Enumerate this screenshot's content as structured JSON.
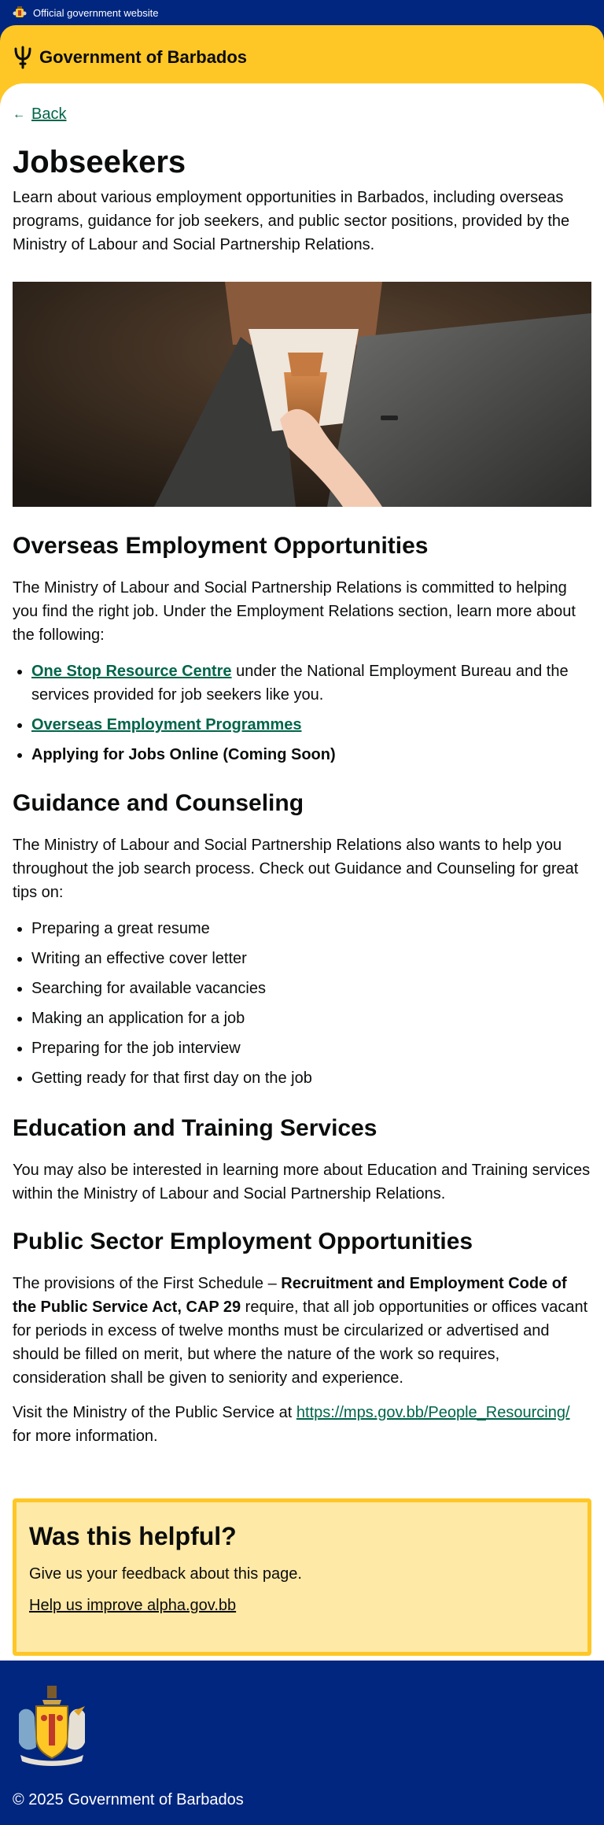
{
  "topbar": {
    "text": "Official government website"
  },
  "header": {
    "site_name": "Government of Barbados"
  },
  "back": {
    "label": "Back"
  },
  "page": {
    "title": "Jobseekers",
    "intro": "Learn about various employment opportunities in Barbados, including overseas programs, guidance for job seekers, and public sector positions, provided by the Ministry of Labour and Social Partnership Relations."
  },
  "overseas": {
    "heading": "Overseas Employment Opportunities",
    "paragraph": "The Ministry of Labour and Social Partnership Relations is committed to helping you find the right job. Under the Employment Relations section, learn more about the following:",
    "item1_link": "One Stop Resource Centre",
    "item1_rest": " under the National Employment Bureau and the services provided for job seekers like you.",
    "item2_link": "Overseas Employment Programmes",
    "item3": "Applying for Jobs Online (Coming Soon)"
  },
  "guidance": {
    "heading": "Guidance and Counseling",
    "paragraph": "The Ministry of Labour and Social Partnership Relations also wants to help you throughout the job search process. Check out Guidance and Counseling for great tips on:",
    "items": [
      "Preparing a great resume",
      "Writing an effective cover letter",
      "Searching for available vacancies",
      "Making an application for a job",
      "Preparing for the job interview",
      "Getting ready for that first day on the job"
    ]
  },
  "education": {
    "heading": "Education and Training Services",
    "paragraph": "You may also be interested in learning more about Education and Training services within the Ministry of Labour and Social Partnership Relations."
  },
  "public_sector": {
    "heading": "Public Sector Employment Opportunities",
    "p1_start": "The provisions of the First Schedule – ",
    "p1_bold": "Recruitment and Employment Code of the Public Service Act, CAP 29",
    "p1_end": " require, that all job opportunities or offices vacant for periods in excess of twelve months must be circularized or advertised and should be filled on merit, but where the nature of the work so requires, consideration shall be given to seniority and experience.",
    "p2_start": "Visit the Ministry of the Public Service at ",
    "p2_link": "https://mps.gov.bb/People_Resourcing/",
    "p2_end": " for more information."
  },
  "feedback": {
    "heading": "Was this helpful?",
    "text": "Give us your feedback about this page.",
    "link": "Help us improve alpha.gov.bb"
  },
  "footer": {
    "copyright": "© 2025 Government of Barbados"
  },
  "colors": {
    "navy": "#00267f",
    "gold": "#ffc726",
    "link_green": "#00654a",
    "feedback_bg": "#ffe9a6"
  }
}
